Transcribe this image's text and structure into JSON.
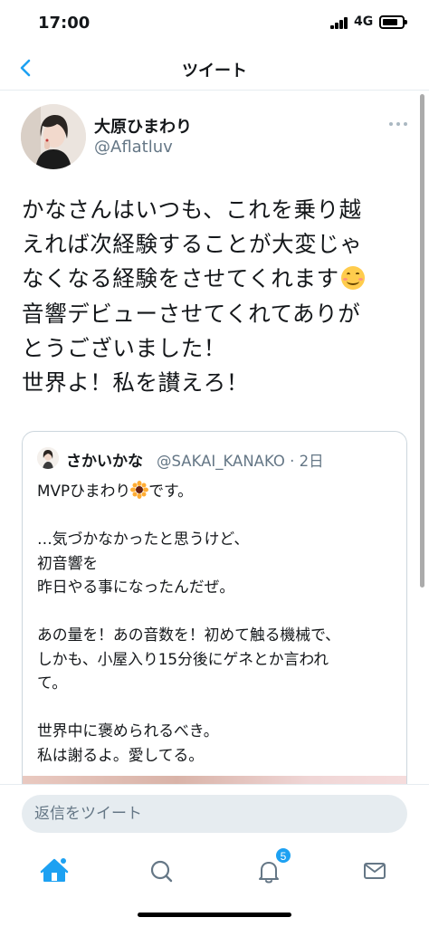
{
  "status": {
    "time": "17:00",
    "network": "4G",
    "battery_level": 0.8
  },
  "nav": {
    "title": "ツイート"
  },
  "tweet": {
    "author_name": "大原ひまわり",
    "author_handle": "@Aflatluv",
    "lines": [
      "かなさんはいつも、これを乗り越",
      "えれば次経験することが大変じゃ",
      "なくなる経験をさせてくれます",
      "音響デビューさせてくれてありが",
      "とうございました！",
      "世界よ！私を讃えろ！"
    ]
  },
  "quote": {
    "author_name": "さかいかな",
    "meta": "@SAKAI_KANAKO · 2日",
    "line1_before": "MVPひまわり",
    "line1_after": "です。",
    "lines": [
      "",
      "…気づかなかったと思うけど、",
      "初音響を",
      "昨日やる事になったんだぜ。",
      "",
      "あの量を！あの音数を！初めて触る機械で、",
      "しかも、小屋入り15分後にゲネとか言われ",
      "て。",
      "",
      "世界中に褒められるべき。",
      "私は謝るよ。愛してる。"
    ]
  },
  "reply": {
    "placeholder": "返信をツイート"
  },
  "tabs": {
    "notification_count": "5"
  },
  "colors": {
    "accent": "#1da1f2",
    "secondary_text": "#657786"
  }
}
